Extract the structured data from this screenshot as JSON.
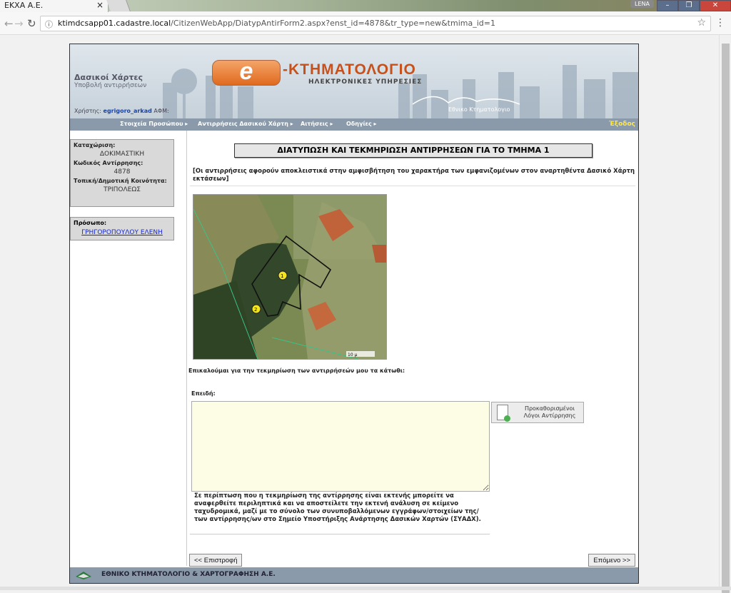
{
  "browser": {
    "tab_title": "ΕΚΧΑ Α.Ε.",
    "tab_close": "×",
    "user_badge": "LENA",
    "url_host": "ktimdcsapp01.cadastre.local",
    "url_path": "/CitizenWebApp/DiatypAntirForm2.aspx?enst_id=4878&tr_type=new&tmima_id=1"
  },
  "banner": {
    "title": "Δασικοί Χάρτες",
    "subtitle": "Υποβολή αντιρρήσεων",
    "user_label": "Χρήστης:",
    "user_name": "egrigoro_arkad",
    "afm_label": "ΑΦΜ:",
    "logo_e": "e",
    "logo_text": "-ΚΤΗΜΑΤΟΛΟΓΙΟ",
    "logo_sub": "ΗΛΕΚΤΡΟΝΙΚΕΣ ΥΠΗΡΕΣΙΕΣ",
    "logo_ek": "Εθνικο Κτηματολογιο"
  },
  "menu": {
    "items": [
      "Στοιχεία Προσώπου ▸",
      "Αντιρρήσεις Δασικού Χάρτη ▸",
      "Αιτήσεις ▸",
      "Οδηγίες ▸"
    ],
    "exit": "Έξοδος"
  },
  "side": {
    "reg_label": "Καταχώριση:",
    "reg_value": "ΔΟΚΙΜΑΣΤΙΚΗ",
    "code_label": "Κωδικός Αντίρρησης:",
    "code_value": "4878",
    "community_label": "Τοπική/Δημοτική Κοινότητα:",
    "community_value": "ΤΡΙΠΟΛΕΩΣ",
    "person_label": "Πρόσωπο:",
    "person_value": "ΓΡΗΓΟΡΟΠΟΥΛΟΥ ΕΛΕΝΗ"
  },
  "main": {
    "heading": "ΔΙΑΤΥΠΩΣΗ ΚΑΙ ΤΕΚΜΗΡΙΩΣΗ ΑΝΤΙΡΡΗΣΕΩΝ ΓΙΑ ΤΟ ΤΜΗΜΑ 1",
    "note": "[Οι αντιρρήσεις αφορούν αποκλειστικά στην αμφισβήτηση του χαρακτήρα των εμφανιζομένων στον αναρτηθέντα Δασικό Χάρτη εκτάσεων]",
    "invoke": "Επικαλούμαι για την τεκμηρίωση των αντιρρήσεών μου τα κάτωθι:",
    "since_label": "Επειδή:",
    "textarea_value": "",
    "predef_button": "Προκαθορισμένοι Λόγοι Αντίρρησης",
    "info": "Σε περίπτωση που η τεκμηρίωση της αντίρρησης είναι εκτενής μπορείτε να αναφερθείτε περιληπτικά και να αποστείλετε την εκτενή ανάλυση σε κείμενο ταχυδρομικά, μαζί με το σύνολο των συνυποβαλλόμενων εγγράφων/στοιχείων της/των αντίρρησης/ων στο Σημείο Υποστήριξης Ανάρτησης Δασικών Χαρτών (ΣΥΑΔΧ).",
    "back_button": "<< Επιστροφή",
    "next_button": "Επόμενο >>",
    "map_labels": [
      "1",
      "2"
    ],
    "scale": "10 μ"
  },
  "footer": {
    "text": "ΕΘΝΙΚΟ ΚΤΗΜΑΤΟΛΟΓΙΟ & ΧΑΡΤΟΓΡΑΦΗΣΗ Α.Ε."
  }
}
